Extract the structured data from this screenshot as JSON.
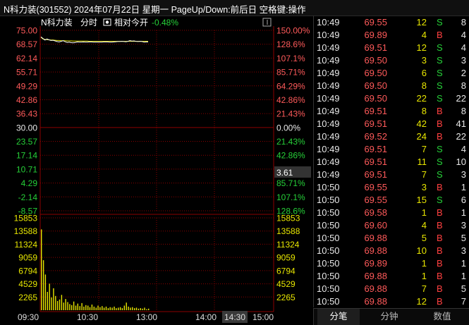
{
  "title": "N科力装(301552) 2024年07月22日 星期一 PageUp/Down:前后日 空格键:操作",
  "header": {
    "stock_name": "N科力装",
    "mode": "分时",
    "relative_label": "相对今开",
    "relative_value": "-0.48%"
  },
  "colors": {
    "up": "#ff5a5a",
    "down": "#26d038",
    "flat": "#e8e8e8",
    "volume": "#e8e600",
    "grid": "#8b0000",
    "price_line": "#ffffff",
    "avg_line": "#e8e600"
  },
  "price_axis": {
    "left": [
      "75.00",
      "68.57",
      "62.14",
      "55.71",
      "49.29",
      "42.86",
      "36.43",
      "30.00",
      "23.57",
      "17.14",
      "10.71",
      "4.29",
      "-2.14",
      "-8.57"
    ],
    "right": [
      "150.00%",
      "128.6%",
      "107.1%",
      "85.71%",
      "64.29%",
      "42.86%",
      "21.43%",
      "0.00%",
      "21.43%",
      "42.86%",
      "64.29%",
      "85.71%",
      "107.1%",
      "128.6%"
    ],
    "base_value": 30.0,
    "max_value": 75.0,
    "min_value": -8.57
  },
  "volume_axis": {
    "left": [
      "15853",
      "13588",
      "11324",
      "9059",
      "6794",
      "4529",
      "2265"
    ],
    "right": [
      "15853",
      "13588",
      "11324",
      "9059",
      "6794",
      "4529",
      "2265"
    ],
    "max_value": 18117
  },
  "cursor_label": "3.61",
  "time_axis": [
    "09:30",
    "10:30",
    "13:00",
    "14:00",
    "14:30",
    "15:00"
  ],
  "highlighted_time": "14:30",
  "chart_data": {
    "type": "line",
    "x_label": "",
    "y_label": "",
    "price_series": [
      {
        "name": "",
        "values": [
          72.0,
          71.2,
          70.5,
          71.0,
          70.6,
          70.3,
          70.4,
          70.1,
          69.8,
          69.6,
          69.9,
          70.2,
          69.7,
          69.4,
          69.5,
          69.3,
          69.2,
          69.4,
          69.6,
          69.5,
          69.5,
          69.6,
          69.5,
          69.5,
          69.6,
          69.6,
          69.5,
          69.5,
          69.5,
          69.5,
          69.5,
          69.6,
          69.6,
          69.6,
          69.5,
          69.5,
          69.6,
          69.7,
          69.8,
          69.8,
          69.9,
          69.8,
          69.7,
          69.9,
          70.2,
          70.0,
          70.1,
          69.9,
          69.8,
          69.9,
          69.8,
          69.5,
          69.6,
          69.6
        ]
      }
    ],
    "avg_series": [
      {
        "name": "",
        "values": [
          71.8,
          71.0,
          70.8,
          70.7,
          70.6,
          70.5,
          70.5,
          70.4,
          70.3,
          70.3,
          70.2,
          70.2,
          70.2,
          70.1,
          70.1,
          70.1,
          70.0,
          70.0,
          70.0,
          70.0,
          70.0,
          70.0,
          70.0,
          70.0,
          69.9,
          69.9,
          69.9,
          69.9,
          69.9,
          69.9,
          69.9,
          69.9,
          69.9,
          69.9,
          69.9,
          69.9,
          69.9,
          69.9,
          69.9,
          69.9,
          69.9,
          69.9,
          69.9,
          69.9,
          69.9,
          69.9,
          69.9,
          69.9,
          69.9,
          69.9,
          69.9,
          69.9,
          69.9,
          69.9
        ]
      }
    ],
    "volume_values": [
      15853,
      9800,
      7000,
      3600,
      5200,
      2500,
      4300,
      2800,
      1800,
      2100,
      3000,
      1500,
      2200,
      1600,
      1200,
      1000,
      1700,
      900,
      1300,
      800,
      1400,
      700,
      1000,
      900,
      600,
      1100,
      700,
      500,
      900,
      600,
      800,
      500,
      700,
      400,
      600,
      500,
      700,
      400,
      500,
      600,
      400,
      900,
      1500,
      700,
      500,
      600,
      400,
      500,
      300,
      400,
      300,
      500,
      200,
      300
    ],
    "ylim": [
      -8.57,
      75.0
    ],
    "volume_ylim": [
      0,
      18117
    ]
  },
  "ticks": [
    {
      "time": "10:49",
      "price": "69.55",
      "vol": "12",
      "bs": "S",
      "count": "8"
    },
    {
      "time": "10:49",
      "price": "69.89",
      "vol": "4",
      "bs": "B",
      "count": "4"
    },
    {
      "time": "10:49",
      "price": "69.51",
      "vol": "12",
      "bs": "S",
      "count": "4"
    },
    {
      "time": "10:49",
      "price": "69.50",
      "vol": "3",
      "bs": "S",
      "count": "3"
    },
    {
      "time": "10:49",
      "price": "69.50",
      "vol": "6",
      "bs": "S",
      "count": "2"
    },
    {
      "time": "10:49",
      "price": "69.50",
      "vol": "8",
      "bs": "S",
      "count": "8"
    },
    {
      "time": "10:49",
      "price": "69.50",
      "vol": "22",
      "bs": "S",
      "count": "22"
    },
    {
      "time": "10:49",
      "price": "69.51",
      "vol": "8",
      "bs": "B",
      "count": "8"
    },
    {
      "time": "10:49",
      "price": "69.51",
      "vol": "42",
      "bs": "B",
      "count": "41"
    },
    {
      "time": "10:49",
      "price": "69.52",
      "vol": "24",
      "bs": "B",
      "count": "22"
    },
    {
      "time": "10:49",
      "price": "69.51",
      "vol": "7",
      "bs": "S",
      "count": "4"
    },
    {
      "time": "10:49",
      "price": "69.51",
      "vol": "11",
      "bs": "S",
      "count": "10"
    },
    {
      "time": "10:49",
      "price": "69.51",
      "vol": "7",
      "bs": "S",
      "count": "3"
    },
    {
      "time": "10:50",
      "price": "69.55",
      "vol": "3",
      "bs": "B",
      "count": "1"
    },
    {
      "time": "10:50",
      "price": "69.55",
      "vol": "15",
      "bs": "S",
      "count": "6"
    },
    {
      "time": "10:50",
      "price": "69.58",
      "vol": "1",
      "bs": "B",
      "count": "1"
    },
    {
      "time": "10:50",
      "price": "69.60",
      "vol": "4",
      "bs": "B",
      "count": "3"
    },
    {
      "time": "10:50",
      "price": "69.88",
      "vol": "5",
      "bs": "B",
      "count": "5"
    },
    {
      "time": "10:50",
      "price": "69.88",
      "vol": "10",
      "bs": "B",
      "count": "3"
    },
    {
      "time": "10:50",
      "price": "69.89",
      "vol": "1",
      "bs": "B",
      "count": "1"
    },
    {
      "time": "10:50",
      "price": "69.88",
      "vol": "1",
      "bs": "B",
      "count": "1"
    },
    {
      "time": "10:50",
      "price": "69.88",
      "vol": "7",
      "bs": "B",
      "count": "5"
    },
    {
      "time": "10:50",
      "price": "69.88",
      "vol": "12",
      "bs": "B",
      "count": "7"
    }
  ],
  "tabs": [
    "分笔",
    "分钟",
    "数值"
  ],
  "active_tab": 0
}
